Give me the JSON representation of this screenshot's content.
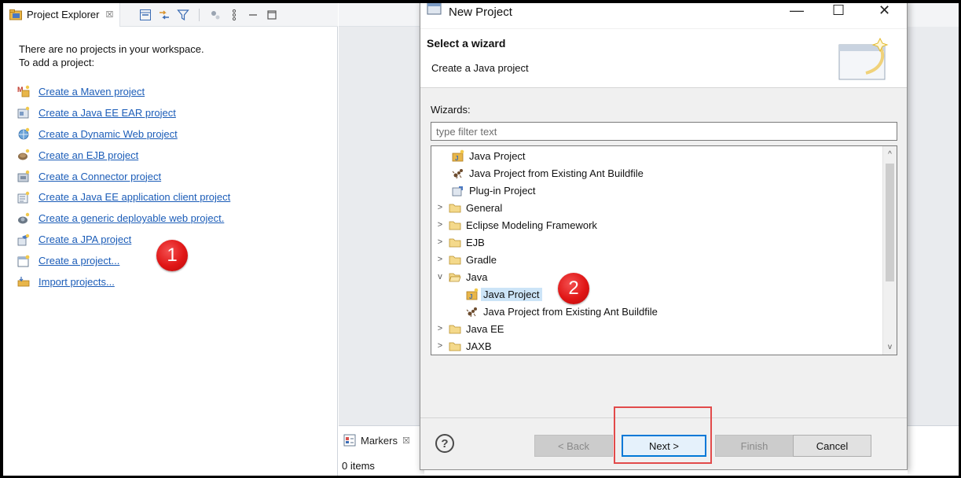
{
  "explorer": {
    "tab_title": "Project Explorer",
    "tab_close": "☒",
    "message_line1": "There are no projects in your workspace.",
    "message_line2": "To add a project:",
    "links": [
      {
        "label": "Create a Maven project",
        "icon": "maven-project-icon"
      },
      {
        "label": "Create a Java EE EAR project",
        "icon": "ear-project-icon"
      },
      {
        "label": "Create a Dynamic Web project",
        "icon": "web-project-icon"
      },
      {
        "label": "Create an EJB project",
        "icon": "ejb-project-icon"
      },
      {
        "label": "Create a Connector project",
        "icon": "connector-project-icon"
      },
      {
        "label": "Create a Java EE application client project",
        "icon": "app-client-project-icon"
      },
      {
        "label": "Create a generic deployable web project.",
        "icon": "deployable-web-project-icon"
      },
      {
        "label": "Create a JPA project",
        "icon": "jpa-project-icon"
      },
      {
        "label": "Create a project...",
        "icon": "new-project-icon"
      },
      {
        "label": "Import projects...",
        "icon": "import-projects-icon"
      }
    ]
  },
  "annotations": {
    "step1": "1",
    "step2": "2"
  },
  "markers": {
    "tab_title": "Markers",
    "tab_close": "☒",
    "count": "0 items"
  },
  "dialog": {
    "title": "New Project",
    "minimize": "—",
    "maximize": "☐",
    "close": "✕",
    "header_title": "Select a wizard",
    "header_desc": "Create a Java project",
    "wizards_label": "Wizards:",
    "filter_placeholder": "type filter text",
    "tree": [
      {
        "label": "Java Project",
        "level": 0,
        "expander": "",
        "icon": "java-project-icon"
      },
      {
        "label": "Java Project from Existing Ant Buildfile",
        "level": 0,
        "expander": "",
        "icon": "ant-buildfile-icon"
      },
      {
        "label": "Plug-in Project",
        "level": 0,
        "expander": "",
        "icon": "plugin-project-icon"
      },
      {
        "label": "General",
        "level": 0,
        "expander": ">",
        "icon": "folder-icon"
      },
      {
        "label": "Eclipse Modeling Framework",
        "level": 0,
        "expander": ">",
        "icon": "folder-icon"
      },
      {
        "label": "EJB",
        "level": 0,
        "expander": ">",
        "icon": "folder-icon"
      },
      {
        "label": "Gradle",
        "level": 0,
        "expander": ">",
        "icon": "folder-icon"
      },
      {
        "label": "Java",
        "level": 0,
        "expander": "v",
        "icon": "folder-open-icon"
      },
      {
        "label": "Java Project",
        "level": 1,
        "expander": "",
        "icon": "java-project-icon",
        "selected": true
      },
      {
        "label": "Java Project from Existing Ant Buildfile",
        "level": 1,
        "expander": "",
        "icon": "ant-buildfile-icon"
      },
      {
        "label": "Java EE",
        "level": 0,
        "expander": ">",
        "icon": "folder-icon"
      },
      {
        "label": "JAXB",
        "level": 0,
        "expander": ">",
        "icon": "folder-icon"
      }
    ],
    "scroll_up": "^",
    "scroll_down": "v",
    "help": "?",
    "buttons": {
      "back": "< Back",
      "next": "Next >",
      "finish": "Finish",
      "cancel": "Cancel"
    }
  }
}
